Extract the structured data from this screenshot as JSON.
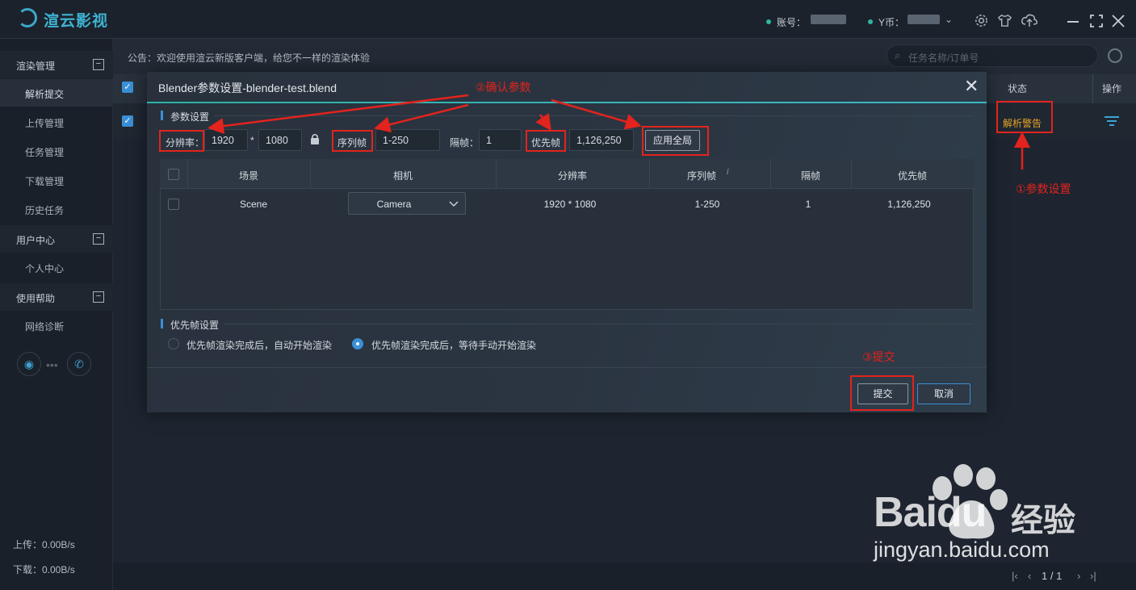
{
  "app": {
    "name": "渲云影视",
    "account_label": "账号：",
    "currency_label": "Y币：",
    "colors": {
      "accent": "#3fb3d2",
      "annotation": "#e3231d",
      "warning": "#e8a326"
    }
  },
  "titlebar": {
    "icons": [
      "gear-icon",
      "shirt-icon",
      "cloud-upload-icon",
      "minimize-icon",
      "maximize-icon",
      "close-icon"
    ]
  },
  "sidebar": {
    "groups": [
      {
        "label": "渲染管理",
        "items": [
          "解析提交",
          "上传管理",
          "任务管理",
          "下载管理",
          "历史任务"
        ]
      },
      {
        "label": "用户中心",
        "items": [
          "个人中心"
        ]
      },
      {
        "label": "使用帮助",
        "items": [
          "网络诊断"
        ]
      }
    ],
    "upload": "上传：0.00B/s",
    "download": "下载：0.00B/s"
  },
  "notice": "公告：欢迎使用渲云新版客户端，给您不一样的渲染体验",
  "search": {
    "placeholder": "任务名称/订单号"
  },
  "table": {
    "col_status": "状态",
    "col_action": "操作",
    "row_status": "解析警告"
  },
  "pagination": {
    "text": "1 / 1"
  },
  "dialog": {
    "title": "Blender参数设置-blender-test.blend",
    "section_params": "参数设置",
    "res_label": "分辨率：",
    "res_w": "1920",
    "res_x": "*",
    "res_h": "1080",
    "seq_label": "序列帧",
    "seq_value": "1-250",
    "step_label": "隔帧：",
    "step_value": "1",
    "prio_label": "优先帧",
    "prio_value": "1,126,250",
    "apply_all": "应用全局",
    "columns": [
      "场景",
      "相机",
      "分辨率",
      "序列帧",
      "隔帧",
      "优先帧"
    ],
    "row": {
      "scene": "Scene",
      "camera": "Camera",
      "resolution": "1920 * 1080",
      "frames": "1-250",
      "step": "1",
      "priority": "1,126,250"
    },
    "section_priority": "优先帧设置",
    "radio_auto": "优先帧渲染完成后，自动开始渲染",
    "radio_manual": "优先帧渲染完成后，等待手动开始渲染",
    "submit": "提交",
    "cancel": "取消"
  },
  "annotations": {
    "step1": "①参数设置",
    "step2": "②确认参数",
    "step3": "③提交"
  },
  "watermark": {
    "brand": "Bai",
    "brand2": "du",
    "cn": "经验",
    "url": "jingyan.baidu.com"
  }
}
